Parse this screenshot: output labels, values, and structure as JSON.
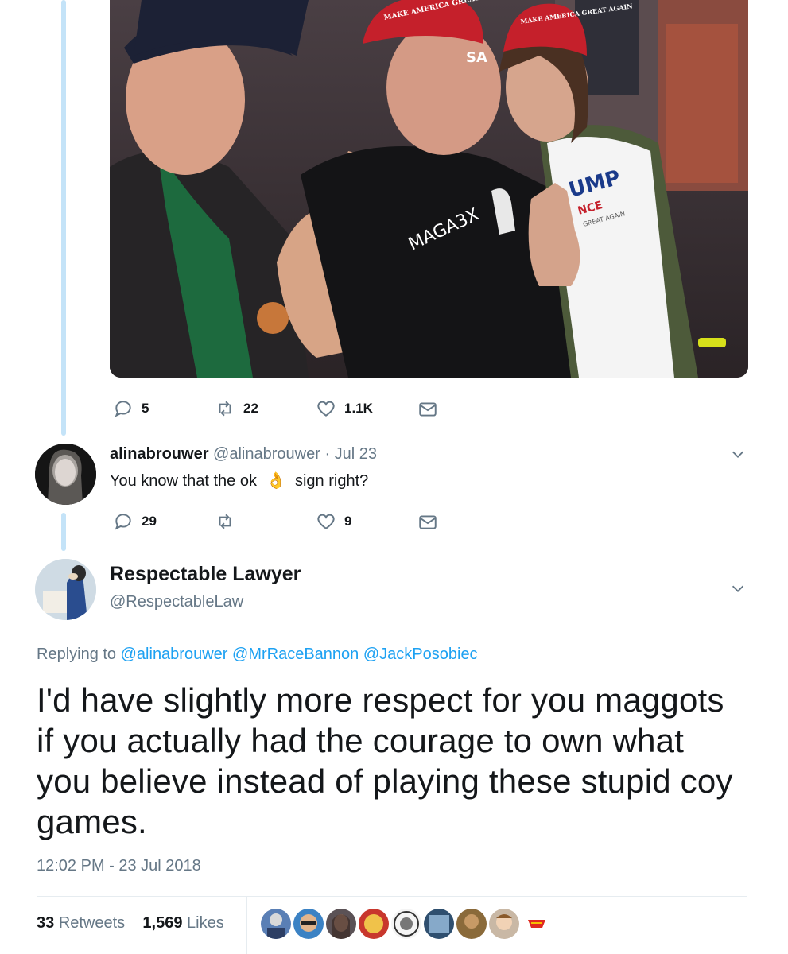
{
  "tweet1": {
    "photo_text": {
      "cap1": "MAKE AMERICA GREAT AGAIN",
      "cap2": "MAKE AMERICA GREAT AGAIN",
      "shirt": "MAGA3X",
      "sign1": "UMP",
      "sign2": "NCE",
      "sign3": "GREAT AGAIN",
      "sign4": "SA"
    },
    "actions": {
      "replies": "5",
      "retweets": "22",
      "likes": "1.1K"
    }
  },
  "reply1": {
    "name": "alinabrouwer",
    "handle": "@alinabrouwer",
    "date": "· Jul 23",
    "text_before": "You know that the ok",
    "emoji": "👌",
    "text_after": "sign right?",
    "actions": {
      "replies": "29",
      "retweets": "",
      "likes": "9"
    }
  },
  "main": {
    "name": "Respectable Lawyer",
    "handle": "@RespectableLaw",
    "replying_prefix": "Replying to",
    "mentions": [
      "@alinabrouwer",
      "@MrRaceBannon",
      "@JackPosobiec"
    ],
    "text": "I'd have slightly more respect for you maggots if you actually had the courage to own what you believe instead of playing these stupid coy games.",
    "timestamp": "12:02 PM - 23 Jul 2018",
    "retweets_count": "33",
    "retweets_label": "Retweets",
    "likes_count": "1,569",
    "likes_label": "Likes"
  },
  "colors": {
    "accent": "#1da1f2",
    "muted": "#657786",
    "thread": "#c4e3f8",
    "text": "#14171a"
  }
}
